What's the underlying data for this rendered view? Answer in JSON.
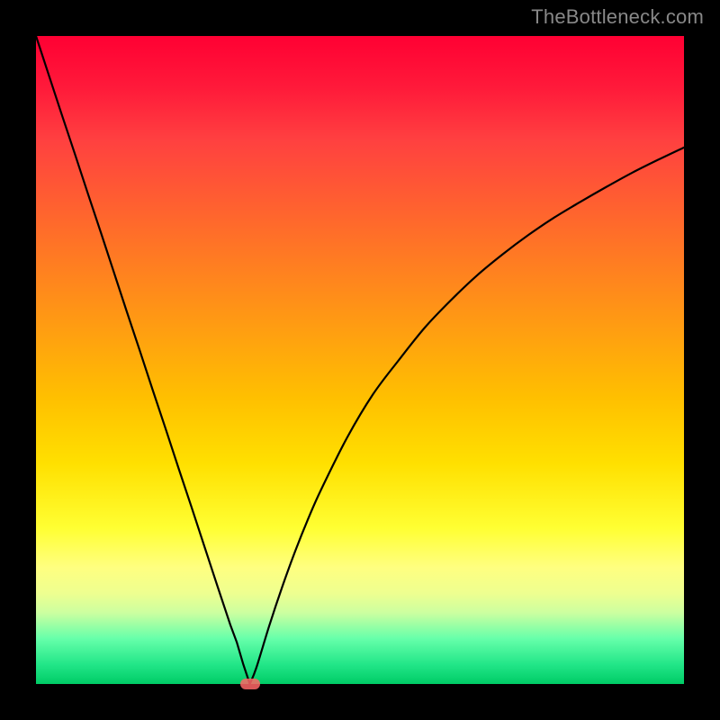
{
  "watermark": "TheBottleneck.com",
  "chart_data": {
    "type": "line",
    "title": "",
    "xlabel": "",
    "ylabel": "",
    "xlim": [
      0,
      100
    ],
    "ylim": [
      0,
      100
    ],
    "x": [
      0,
      2,
      4,
      6,
      8,
      10,
      12,
      14,
      16,
      18,
      20,
      22,
      24,
      26,
      28,
      30,
      31,
      32,
      33,
      34,
      36,
      38,
      40,
      42,
      44,
      48,
      52,
      56,
      60,
      64,
      68,
      72,
      76,
      80,
      84,
      88,
      92,
      96,
      100
    ],
    "values": [
      100,
      93.9,
      87.8,
      81.8,
      75.7,
      69.7,
      63.6,
      57.5,
      51.5,
      45.4,
      39.4,
      33.3,
      27.3,
      21.2,
      15.1,
      9.1,
      6.4,
      3.0,
      0.0,
      2.5,
      9.0,
      15.0,
      20.5,
      25.5,
      30.0,
      38.0,
      44.7,
      50.0,
      55.0,
      59.2,
      63.0,
      66.3,
      69.3,
      72.0,
      74.4,
      76.7,
      78.9,
      80.9,
      82.8
    ],
    "marker": {
      "x": 33,
      "y": 0
    },
    "background": "red-green-vertical-gradient"
  }
}
